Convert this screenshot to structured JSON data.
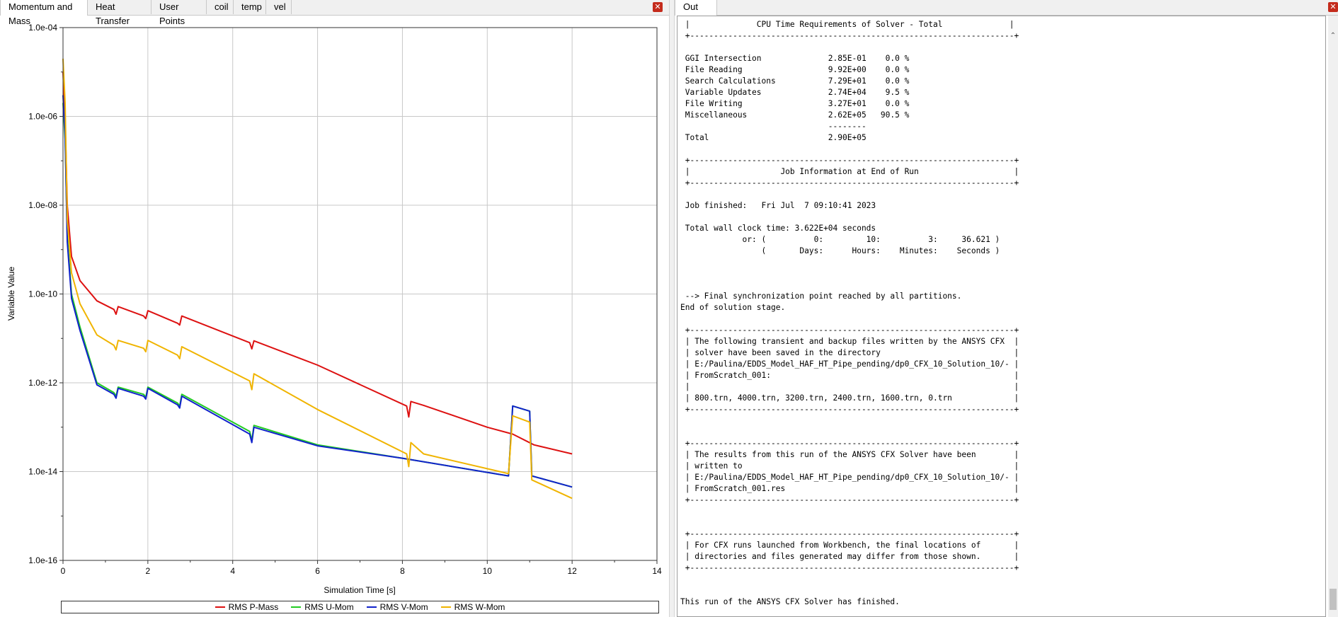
{
  "left_pane": {
    "tabs": [
      {
        "label": "Momentum and Mass",
        "active": true
      },
      {
        "label": "Heat Transfer",
        "active": false
      },
      {
        "label": "User Points",
        "active": false
      },
      {
        "label": "coil",
        "active": false
      },
      {
        "label": "temp",
        "active": false
      },
      {
        "label": "vel",
        "active": false
      }
    ],
    "close_icon": "close-icon"
  },
  "right_pane": {
    "tab_label": "Out File",
    "close_icon": "close-icon",
    "output_lines": [
      " |              CPU Time Requirements of Solver - Total              |",
      " +--------------------------------------------------------------------+",
      "",
      " GGI Intersection              2.85E-01    0.0 %",
      " File Reading                  9.92E+00    0.0 %",
      " Search Calculations           7.29E+01    0.0 %",
      " Variable Updates              2.74E+04    9.5 %",
      " File Writing                  3.27E+01    0.0 %",
      " Miscellaneous                 2.62E+05   90.5 %",
      "                               --------",
      " Total                         2.90E+05",
      "",
      " +--------------------------------------------------------------------+",
      " |                   Job Information at End of Run                    |",
      " +--------------------------------------------------------------------+",
      "",
      " Job finished:   Fri Jul  7 09:10:41 2023",
      "",
      " Total wall clock time: 3.622E+04 seconds",
      "             or: (          0:         10:          3:     36.621 )",
      "                 (       Days:      Hours:    Minutes:    Seconds )",
      "",
      "",
      "",
      " --> Final synchronization point reached by all partitions.",
      "End of solution stage.",
      "",
      " +--------------------------------------------------------------------+",
      " | The following transient and backup files written by the ANSYS CFX  |",
      " | solver have been saved in the directory                            |",
      " | E:/Paulina/EDDS_Model_HAF_HT_Pipe_pending/dp0_CFX_10_Solution_10/- |",
      " | FromScratch_001:                                                   |",
      " |                                                                    |",
      " | 800.trn, 4000.trn, 3200.trn, 2400.trn, 1600.trn, 0.trn             |",
      " +--------------------------------------------------------------------+",
      "",
      "",
      " +--------------------------------------------------------------------+",
      " | The results from this run of the ANSYS CFX Solver have been        |",
      " | written to                                                         |",
      " | E:/Paulina/EDDS_Model_HAF_HT_Pipe_pending/dp0_CFX_10_Solution_10/- |",
      " | FromScratch_001.res                                                |",
      " +--------------------------------------------------------------------+",
      "",
      "",
      " +--------------------------------------------------------------------+",
      " | For CFX runs launched from Workbench, the final locations of       |",
      " | directories and files generated may differ from those shown.       |",
      " +--------------------------------------------------------------------+",
      "",
      "",
      "This run of the ANSYS CFX Solver has finished."
    ]
  },
  "chart_data": {
    "type": "line",
    "xlabel": "Simulation Time [s]",
    "ylabel": "Variable Value",
    "xlim": [
      0,
      14
    ],
    "ylim": [
      1e-16,
      0.0001
    ],
    "yscale": "log",
    "grid": true,
    "legend_position": "bottom",
    "x_ticks": [
      "0",
      "2",
      "4",
      "6",
      "8",
      "10",
      "12",
      "14"
    ],
    "y_ticks": [
      "1.0e-16",
      "1.0e-14",
      "1.0e-12",
      "1.0e-10",
      "1.0e-08",
      "1.0e-06",
      "1.0e-04"
    ],
    "series": [
      {
        "name": "RMS P-Mass",
        "color": "#dd1111",
        "points": [
          [
            0,
            1e-05
          ],
          [
            0.05,
            8e-07
          ],
          [
            0.1,
            1e-08
          ],
          [
            0.2,
            7e-10
          ],
          [
            0.4,
            2e-10
          ],
          [
            0.8,
            7e-11
          ],
          [
            1.2,
            4.5e-11
          ],
          [
            1.25,
            3.5e-11
          ],
          [
            1.3,
            5.2e-11
          ],
          [
            1.9,
            3.2e-11
          ],
          [
            1.95,
            2.8e-11
          ],
          [
            2.0,
            4.2e-11
          ],
          [
            2.7,
            2.2e-11
          ],
          [
            2.75,
            2e-11
          ],
          [
            2.8,
            3.2e-11
          ],
          [
            4.4,
            8e-12
          ],
          [
            4.45,
            5.8e-12
          ],
          [
            4.5,
            8.8e-12
          ],
          [
            6,
            2.5e-12
          ],
          [
            8.1,
            3e-13
          ],
          [
            8.15,
            1.7e-13
          ],
          [
            8.2,
            3.8e-13
          ],
          [
            8.5,
            3.1e-13
          ],
          [
            10,
            1e-13
          ],
          [
            10.6,
            7e-14
          ],
          [
            11.1,
            4e-14
          ],
          [
            12,
            2.5e-14
          ]
        ]
      },
      {
        "name": "RMS U-Mom",
        "color": "#22cc22",
        "points": [
          [
            0,
            2e-06
          ],
          [
            0.05,
            3e-07
          ],
          [
            0.1,
            2e-09
          ],
          [
            0.2,
            1e-10
          ],
          [
            0.4,
            1.8e-11
          ],
          [
            0.8,
            1e-12
          ],
          [
            1.2,
            6e-13
          ],
          [
            1.25,
            5e-13
          ],
          [
            1.3,
            8e-13
          ],
          [
            1.9,
            5.5e-13
          ],
          [
            1.95,
            4.7e-13
          ],
          [
            2.0,
            8e-13
          ],
          [
            2.7,
            3.5e-13
          ],
          [
            2.75,
            3e-13
          ],
          [
            2.8,
            5.5e-13
          ],
          [
            4.4,
            8e-14
          ],
          [
            4.45,
            5e-14
          ],
          [
            4.5,
            1.1e-13
          ],
          [
            6,
            4e-14
          ],
          [
            8,
            2e-14
          ],
          [
            10.5,
            8e-15
          ],
          [
            10.6,
            3e-13
          ],
          [
            11.0,
            2.3e-13
          ],
          [
            11.05,
            8e-15
          ],
          [
            12,
            4.5e-15
          ]
        ]
      },
      {
        "name": "RMS V-Mom",
        "color": "#1122cc",
        "points": [
          [
            0,
            3e-06
          ],
          [
            0.05,
            4e-07
          ],
          [
            0.1,
            1.5e-09
          ],
          [
            0.2,
            8e-11
          ],
          [
            0.4,
            1.5e-11
          ],
          [
            0.8,
            9e-13
          ],
          [
            1.2,
            5.5e-13
          ],
          [
            1.25,
            4.5e-13
          ],
          [
            1.3,
            7.5e-13
          ],
          [
            1.9,
            5e-13
          ],
          [
            1.95,
            4.3e-13
          ],
          [
            2.0,
            7.5e-13
          ],
          [
            2.7,
            3.2e-13
          ],
          [
            2.75,
            2.7e-13
          ],
          [
            2.8,
            5e-13
          ],
          [
            4.4,
            7e-14
          ],
          [
            4.45,
            4.5e-14
          ],
          [
            4.5,
            1e-13
          ],
          [
            6,
            3.8e-14
          ],
          [
            8,
            2e-14
          ],
          [
            10.5,
            8e-15
          ],
          [
            10.6,
            3e-13
          ],
          [
            11.0,
            2.3e-13
          ],
          [
            11.05,
            8e-15
          ],
          [
            12,
            4.5e-15
          ]
        ]
      },
      {
        "name": "RMS W-Mom",
        "color": "#f0b400",
        "points": [
          [
            0,
            2e-05
          ],
          [
            0.05,
            2e-06
          ],
          [
            0.1,
            5e-09
          ],
          [
            0.2,
            3e-10
          ],
          [
            0.4,
            6e-11
          ],
          [
            0.8,
            1.2e-11
          ],
          [
            1.2,
            7e-12
          ],
          [
            1.25,
            5.5e-12
          ],
          [
            1.3,
            9e-12
          ],
          [
            1.9,
            6e-12
          ],
          [
            1.95,
            5e-12
          ],
          [
            2.0,
            9e-12
          ],
          [
            2.7,
            4.2e-12
          ],
          [
            2.75,
            3.5e-12
          ],
          [
            2.8,
            6.5e-12
          ],
          [
            4.4,
            1.1e-12
          ],
          [
            4.45,
            7e-13
          ],
          [
            4.5,
            1.6e-12
          ],
          [
            6,
            2.5e-13
          ],
          [
            8.1,
            2.5e-14
          ],
          [
            8.15,
            1.3e-14
          ],
          [
            8.2,
            4.5e-14
          ],
          [
            8.5,
            2.5e-14
          ],
          [
            10.5,
            9e-15
          ],
          [
            10.6,
            1.8e-13
          ],
          [
            11.0,
            1.3e-13
          ],
          [
            11.05,
            6.5e-15
          ],
          [
            12,
            2.5e-15
          ]
        ]
      }
    ]
  }
}
